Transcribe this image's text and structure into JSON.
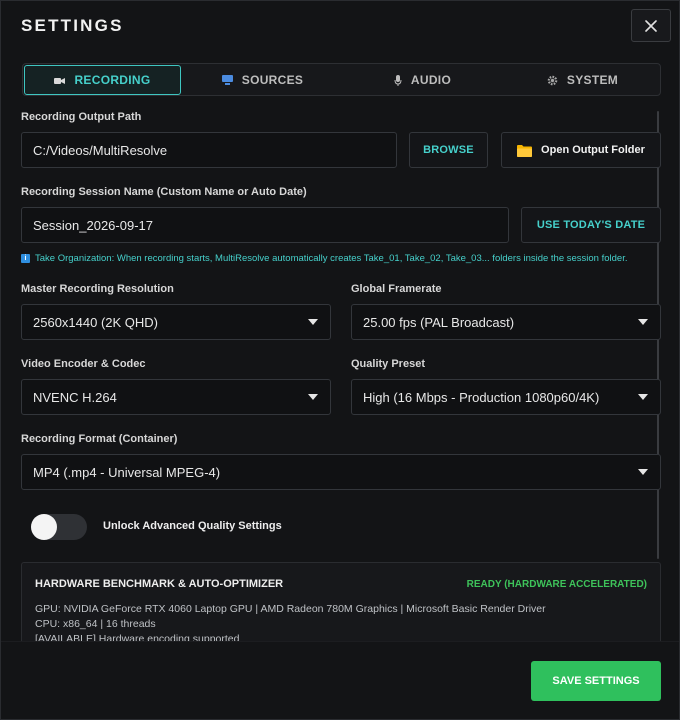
{
  "window": {
    "title": "SETTINGS"
  },
  "tabs": [
    {
      "label": "RECORDING",
      "icon": "camera-icon",
      "active": true
    },
    {
      "label": "SOURCES",
      "icon": "monitor-icon",
      "active": false
    },
    {
      "label": "AUDIO",
      "icon": "microphone-icon",
      "active": false
    },
    {
      "label": "SYSTEM",
      "icon": "gear-icon",
      "active": false
    }
  ],
  "recording": {
    "output_path_label": "Recording Output Path",
    "output_path_value": "C:/Videos/MultiResolve",
    "browse_label": "BROWSE",
    "open_folder_label": "Open Output Folder",
    "session_name_label": "Recording Session Name (Custom Name or Auto Date)",
    "session_name_value": "Session_2026-09-17",
    "use_today_label": "USE TODAY'S DATE",
    "info_text": "Take Organization: When recording starts, MultiResolve automatically creates Take_01, Take_02, Take_03... folders inside the session folder.",
    "resolution_label": "Master Recording Resolution",
    "resolution_value": "2560x1440 (2K QHD)",
    "framerate_label": "Global Framerate",
    "framerate_value": "25.00 fps (PAL Broadcast)",
    "encoder_label": "Video Encoder & Codec",
    "encoder_value": "NVENC H.264",
    "quality_label": "Quality Preset",
    "quality_value": "High (16 Mbps - Production 1080p60/4K)",
    "format_label": "Recording Format (Container)",
    "format_value": "MP4 (.mp4 - Universal MPEG-4)",
    "advanced_toggle_label": "Unlock Advanced Quality Settings",
    "advanced_toggle_on": false
  },
  "benchmark": {
    "title": "HARDWARE BENCHMARK & AUTO-OPTIMIZER",
    "status": "READY (HARDWARE ACCELERATED)",
    "gpu_line": "GPU: NVIDIA GeForce RTX 4060 Laptop GPU | AMD Radeon 780M Graphics | Microsoft Basic Render Driver",
    "cpu_line": "CPU: x86_64 | 16 threads",
    "available_line": "[AVAILABLE] Hardware encoding supported"
  },
  "footer": {
    "save_label": "SAVE SETTINGS"
  },
  "colors": {
    "accent": "#46d0cb",
    "success": "#2fc05d",
    "background": "#131416",
    "folder": "#f5b400"
  }
}
